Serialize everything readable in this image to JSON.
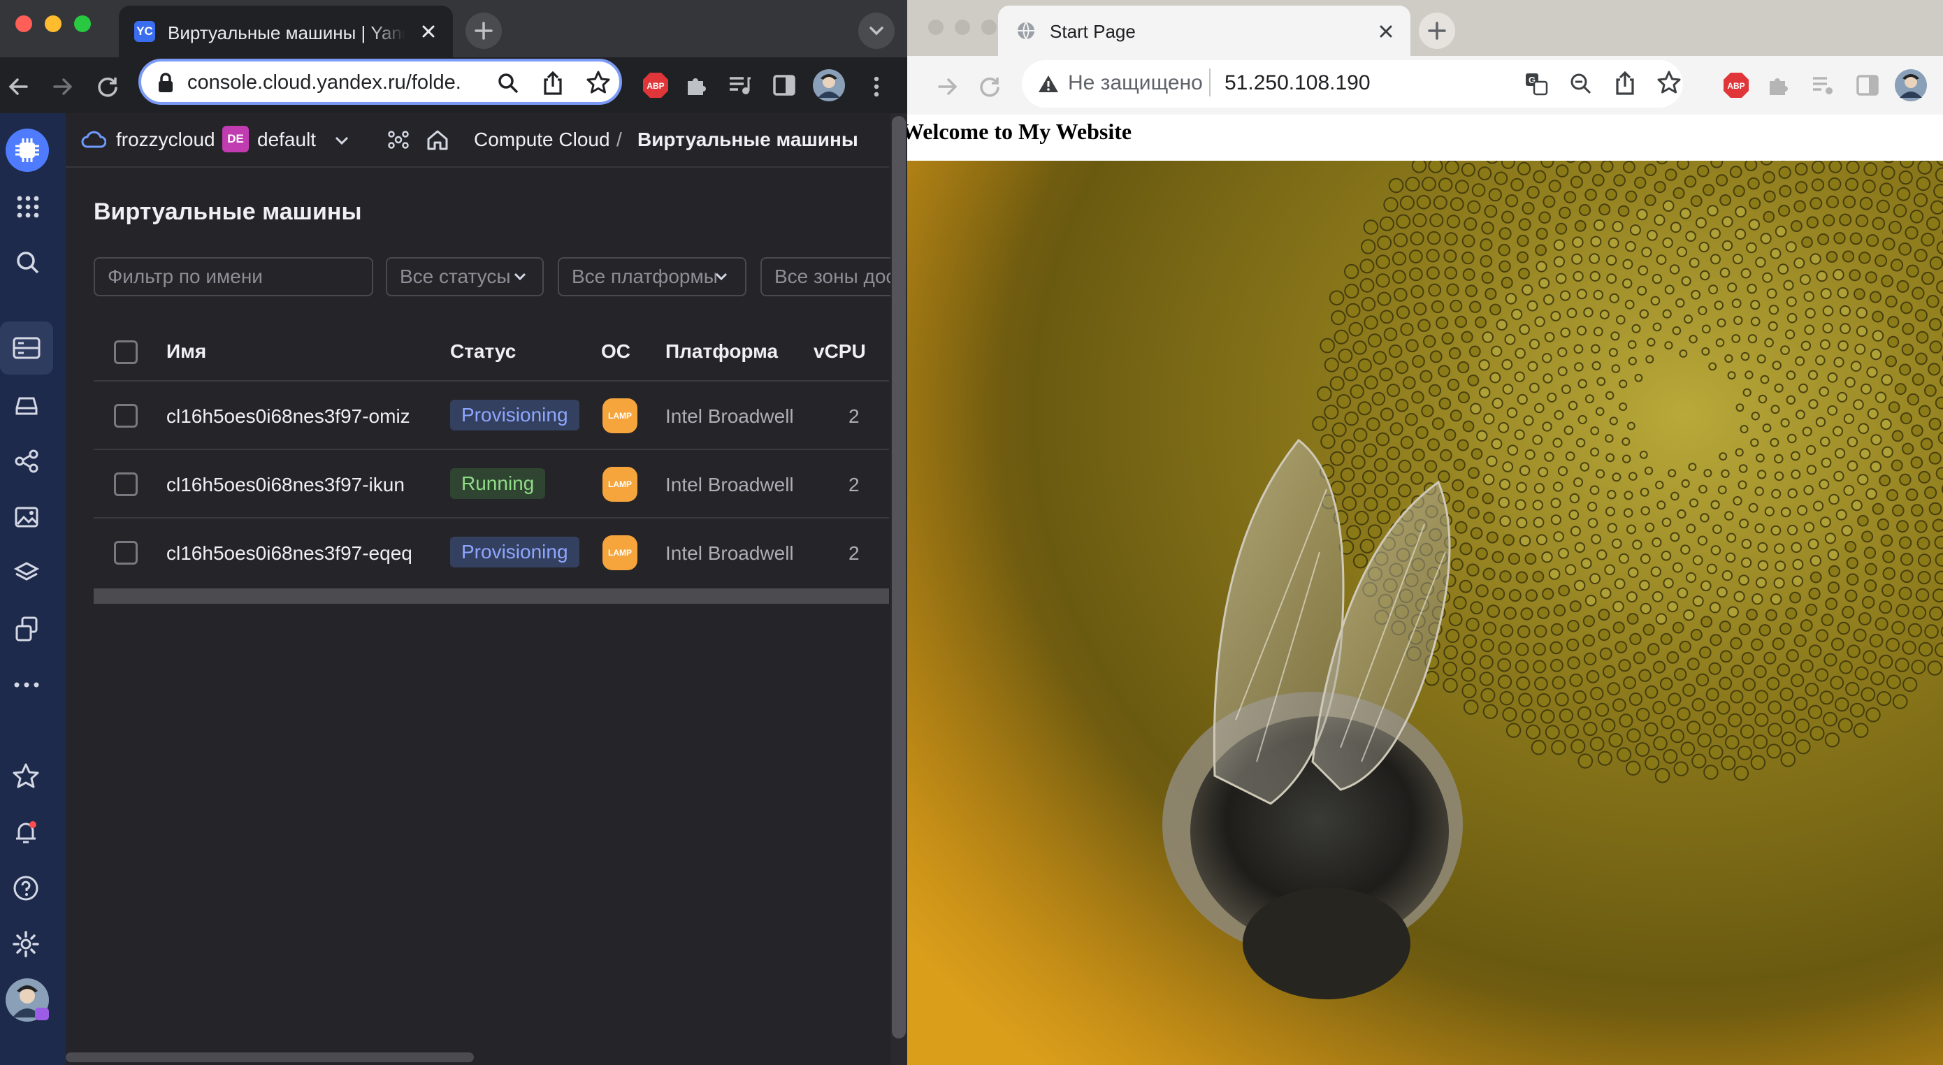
{
  "left_browser": {
    "tab_title": "Виртуальные машины | Yandex Cloud",
    "tab_favicon": "YC",
    "url": "console.cloud.yandex.ru/folde..."
  },
  "yc": {
    "cloud_name": "frozzycloud",
    "folder_badge": "DE",
    "folder_name": "default",
    "breadcrumb": {
      "service": "Compute Cloud",
      "separator": "/",
      "current": "Виртуальные машины"
    },
    "page_title": "Виртуальные машины",
    "filters": {
      "name_placeholder": "Фильтр по имени",
      "statuses": "Все статусы",
      "platforms": "Все платформы",
      "zones": "Все зоны доступности"
    },
    "table": {
      "columns": [
        "Имя",
        "Статус",
        "ОС",
        "Платформа",
        "vCPU"
      ],
      "rows": [
        {
          "name": "cl16h5oes0i68nes3f97-omiz",
          "status": "Provisioning",
          "os": "LAMP",
          "platform": "Intel Broadwell",
          "vcpu": "2"
        },
        {
          "name": "cl16h5oes0i68nes3f97-ikun",
          "status": "Running",
          "os": "LAMP",
          "platform": "Intel Broadwell",
          "vcpu": "2"
        },
        {
          "name": "cl16h5oes0i68nes3f97-eqeq",
          "status": "Provisioning",
          "os": "LAMP",
          "platform": "Intel Broadwell",
          "vcpu": "2"
        }
      ]
    },
    "colors": {
      "rail": "#1d2a4b",
      "accent": "#4f7cff",
      "provisioning": "#8ea6ff",
      "running": "#8fdc86"
    }
  },
  "right_browser": {
    "tab_title": "Start Page",
    "security_label": "Не защищено",
    "url": "51.250.108.190",
    "page_heading": "Welcome to My Website",
    "image_subject": "bee on sunflower"
  }
}
